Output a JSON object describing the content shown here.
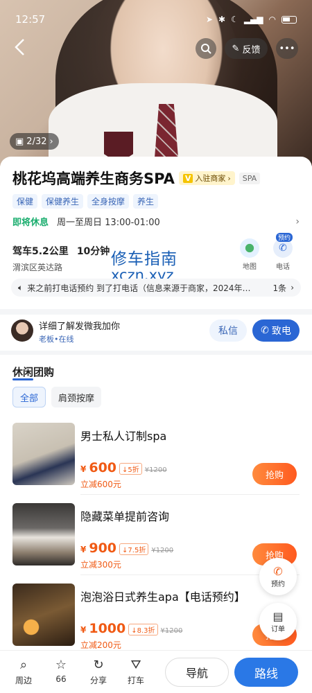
{
  "status": {
    "time": "12:57"
  },
  "hero": {
    "feedback_label": "反馈",
    "photo_counter": "2/32"
  },
  "shop": {
    "name": "桃花坞高端养生商务SPA",
    "merchant_badge": "入驻商家",
    "merchant_badge_mark": "V",
    "category_tag": "SPA",
    "tags": [
      "保健",
      "保健养生",
      "全身按摩",
      "养生"
    ],
    "hours_state": "即将休息",
    "hours_text": "周一至周日 13:00-01:00",
    "distance_drive": "驾车5.2公里",
    "distance_time": "10分钟",
    "district": "渭滨区英达路",
    "map_label": "地图",
    "phone_label": "电话",
    "phone_badge": "预约",
    "notice_text": "来之前打电话预约 到了打电话（信息来源于商家，2024年…",
    "notice_count": "1条"
  },
  "watermark": {
    "cn": "修车指南",
    "en": "xczn.xyz"
  },
  "owner": {
    "message": "详细了解发微我加你",
    "role": "老板",
    "online": "在线",
    "private_msg": "私信",
    "call": "致电"
  },
  "deals_section": {
    "title": "休闲团购",
    "filters": [
      "全部",
      "肩颈按摩"
    ]
  },
  "deals": [
    {
      "name": "男士私人订制spa",
      "price": "600",
      "discount": "5折",
      "original": "¥1200",
      "save": "立减600元",
      "buy": "抢购"
    },
    {
      "name": "隐藏菜单提前咨询",
      "price": "900",
      "discount": "7.5折",
      "original": "¥1200",
      "save": "立减300元",
      "buy": "抢购"
    },
    {
      "name": "泡泡浴日式养生apa【电话预约】",
      "price": "1000",
      "discount": "8.3折",
      "original": "¥1200",
      "save": "立减200元",
      "buy": "抢购"
    }
  ],
  "floating": {
    "book": "预约",
    "order": "订单"
  },
  "bottom_bar": {
    "nearby": "周边",
    "fav_count": "66",
    "share": "分享",
    "taxi": "打车",
    "navigate": "导航",
    "route": "路线"
  },
  "currency": "¥",
  "colors": {
    "accent": "#2a66d4",
    "price": "#f05a14",
    "open_status": "#1aad6e"
  }
}
